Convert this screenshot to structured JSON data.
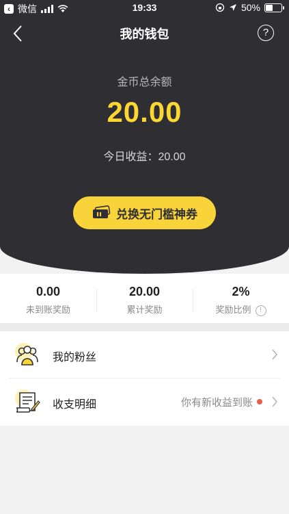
{
  "status": {
    "carrier": "微信",
    "time": "19:33",
    "battery": "50%",
    "battery_level": 0.5
  },
  "nav": {
    "title": "我的钱包",
    "help": "?"
  },
  "balance": {
    "label": "金币总余额",
    "amount": "20.00",
    "today": "今日收益：20.00"
  },
  "redeem": {
    "label": "兑换无门槛神券"
  },
  "stats": [
    {
      "value": "0.00",
      "label": "未到账奖励"
    },
    {
      "value": "20.00",
      "label": "累计奖励"
    },
    {
      "value": "2%",
      "label": "奖励比例",
      "info": "!"
    }
  ],
  "list": [
    {
      "label": "我的粉丝"
    },
    {
      "label": "收支明细",
      "note": "你有新收益到账"
    }
  ],
  "colors": {
    "accent": "#fcd734",
    "dark": "#2f2f33",
    "dot": "#ef5b4a"
  }
}
